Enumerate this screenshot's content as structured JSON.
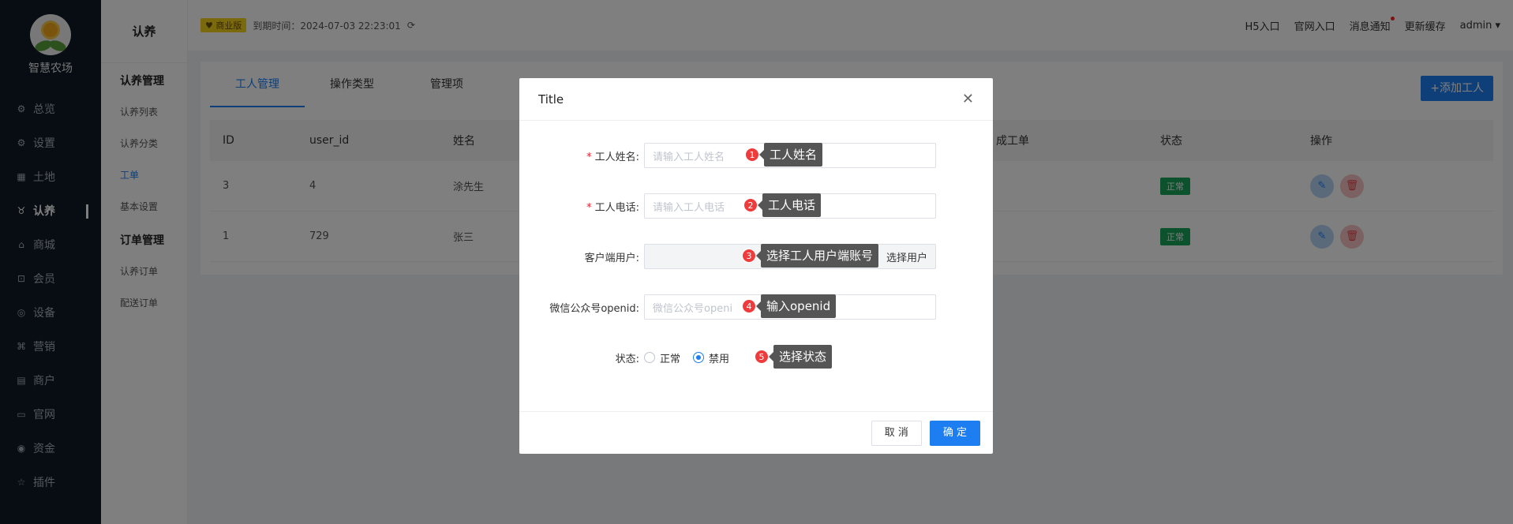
{
  "sidebar": {
    "brand": "智慧农场",
    "items": [
      {
        "icon": "⚙",
        "label": "总览"
      },
      {
        "icon": "⚙",
        "label": "设置"
      },
      {
        "icon": "▦",
        "label": "土地"
      },
      {
        "icon": "♉",
        "label": "认养"
      },
      {
        "icon": "⌂",
        "label": "商城"
      },
      {
        "icon": "⊡",
        "label": "会员"
      },
      {
        "icon": "◎",
        "label": "设备"
      },
      {
        "icon": "⌘",
        "label": "营销"
      },
      {
        "icon": "▤",
        "label": "商户"
      },
      {
        "icon": "▭",
        "label": "官网"
      },
      {
        "icon": "◉",
        "label": "资金"
      },
      {
        "icon": "☆",
        "label": "插件"
      }
    ]
  },
  "subside": {
    "title": "认养",
    "groups": [
      {
        "title": "认养管理",
        "links": [
          "认养列表",
          "认养分类",
          "工单",
          "基本设置"
        ]
      },
      {
        "title": "订单管理",
        "links": [
          "认养订单",
          "配送订单"
        ]
      }
    ]
  },
  "topbar": {
    "badge": "商业版",
    "expire": "到期时间：2024-07-03 22:23:01",
    "links": [
      "H5入口",
      "官网入口",
      "消息通知",
      "更新缓存",
      "admin ▾"
    ]
  },
  "content": {
    "tabs": [
      "工人管理",
      "操作类型",
      "管理项"
    ],
    "add_button": "+添加工人",
    "headers": [
      "ID",
      "user_id",
      "姓名",
      "成工单",
      "状态",
      "操作"
    ],
    "rows": [
      {
        "id": "3",
        "user_id": "4",
        "name": "涂先生",
        "status": "正常"
      },
      {
        "id": "1",
        "user_id": "729",
        "name": "张三",
        "status": "正常"
      }
    ]
  },
  "modal": {
    "title": "Title",
    "fields": {
      "name": {
        "label": "工人姓名:",
        "placeholder": "请输入工人姓名"
      },
      "phone": {
        "label": "工人电话:",
        "placeholder": "请输入工人电话"
      },
      "client": {
        "label": "客户端用户:",
        "button": "选择用户"
      },
      "openid": {
        "label": "微信公众号openid:",
        "placeholder": "微信公众号openi"
      },
      "status": {
        "label": "状态:",
        "options": [
          "正常",
          "禁用"
        ],
        "selected": "禁用"
      }
    },
    "hints": [
      {
        "num": "1",
        "text": "工人姓名"
      },
      {
        "num": "2",
        "text": "工人电话"
      },
      {
        "num": "3",
        "text": "选择工人用户端账号"
      },
      {
        "num": "4",
        "text": "输入openid"
      },
      {
        "num": "5",
        "text": "选择状态"
      }
    ],
    "cancel": "取 消",
    "ok": "确 定"
  }
}
